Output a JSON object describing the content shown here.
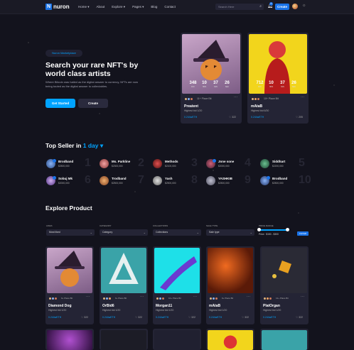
{
  "nav": {
    "logo": "nuron",
    "menu": [
      "Home ▾",
      "About",
      "Explore ▾",
      "Pages ▾",
      "Blog",
      "Contact"
    ],
    "search_placeholder": "Search Here",
    "notification_count": "6",
    "create_label": "Create"
  },
  "hero": {
    "tag": "Nuron Marketplace",
    "heading": "Search your rare NFT's by world class artists",
    "paragraph": "Where Bitcoin was hailed as the digital answer to currency, NFTs are now being touted as the digital answer to collectables.",
    "start_label": "Get Started",
    "create_label": "Create"
  },
  "hero_cards": [
    {
      "title": "Preatent",
      "bid": "Highest bid 1/20",
      "price": "0.244wETH",
      "likes": "322",
      "place": "11+ Place Bit",
      "countdown": [
        {
          "n": "348",
          "l": "DAY"
        },
        {
          "n": "10",
          "l": "HRS"
        },
        {
          "n": "37",
          "l": "MIN"
        },
        {
          "n": "26",
          "l": "SEC"
        }
      ]
    },
    {
      "title": "mAtaB",
      "bid": "Highest bid 6/30",
      "price": "0.244wETH",
      "likes": "205",
      "place": "10+ Place Bit",
      "countdown": [
        {
          "n": "712",
          "l": "DAY"
        },
        {
          "n": "10",
          "l": "HRS"
        },
        {
          "n": "37",
          "l": "MIN"
        },
        {
          "n": "26",
          "l": "SEC"
        }
      ]
    }
  ],
  "sellers_section": {
    "title": "Top Seller in",
    "period": "1 day ▾"
  },
  "sellers": [
    {
      "name": "Brodband",
      "value": "$2500,000",
      "rank": "1"
    },
    {
      "name": "Ms. Parkline",
      "value": "$2300,000",
      "rank": "2"
    },
    {
      "name": "Methods",
      "value": "$2100,000",
      "rank": "3"
    },
    {
      "name": "Jone sone",
      "value": "$2000,000",
      "rank": "4"
    },
    {
      "name": "Siddhart",
      "value": "$2200,000",
      "rank": "5"
    },
    {
      "name": "Sobuj Mk",
      "value": "$2000,000",
      "rank": "6"
    },
    {
      "name": "Trodband",
      "value": "$2500,000",
      "rank": "7"
    },
    {
      "name": "Yash",
      "value": "$2500,000",
      "rank": "8"
    },
    {
      "name": "YASHKIB",
      "value": "$2500,000",
      "rank": "9"
    },
    {
      "name": "Brodband",
      "value": "$2500,000",
      "rank": "10"
    }
  ],
  "explore": {
    "title": "Explore Product",
    "filters": [
      {
        "label": "LIKES",
        "value": "Most liked"
      },
      {
        "label": "CATEGORY",
        "value": "Category"
      },
      {
        "label": "COLLECTIONS",
        "value": "Collections"
      },
      {
        "label": "SALE TYPE",
        "value": "Sale type"
      }
    ],
    "price_label": "PRICE RANGE",
    "price_text": "Price : $150 - $300",
    "filter_label": "FILTER"
  },
  "products": [
    {
      "title": "Diamond Dog",
      "bid": "Highest bid 1/20",
      "price": "0.244wETH",
      "likes": "322",
      "place": "9+ Place Bit"
    },
    {
      "title": "OrBid6",
      "bid": "Highest bid 1/20",
      "price": "0.244wETH",
      "likes": "322",
      "place": "9+ Place Bit"
    },
    {
      "title": "Morgan11",
      "bid": "Highest bid 1/20",
      "price": "0.244wETH",
      "likes": "322",
      "place": "10+ Place Bit"
    },
    {
      "title": "mAtaB",
      "bid": "Highest bid 1/20",
      "price": "0.244wETH",
      "likes": "322",
      "place": "9+ Place Bit"
    },
    {
      "title": "PlatOrgan",
      "bid": "Highest bid 1/20",
      "price": "0.244wETH",
      "likes": "322",
      "place": "12+ Place Bit"
    }
  ],
  "icons": {
    "search": "search-icon",
    "bell": "bell-icon",
    "heart": "heart-icon",
    "menu_dots": "dots-icon",
    "theme": "sun-icon"
  },
  "colors": {
    "accent": "#00a3ff",
    "brand": "#1a73e8",
    "background": "#13131d",
    "card": "#242435"
  }
}
